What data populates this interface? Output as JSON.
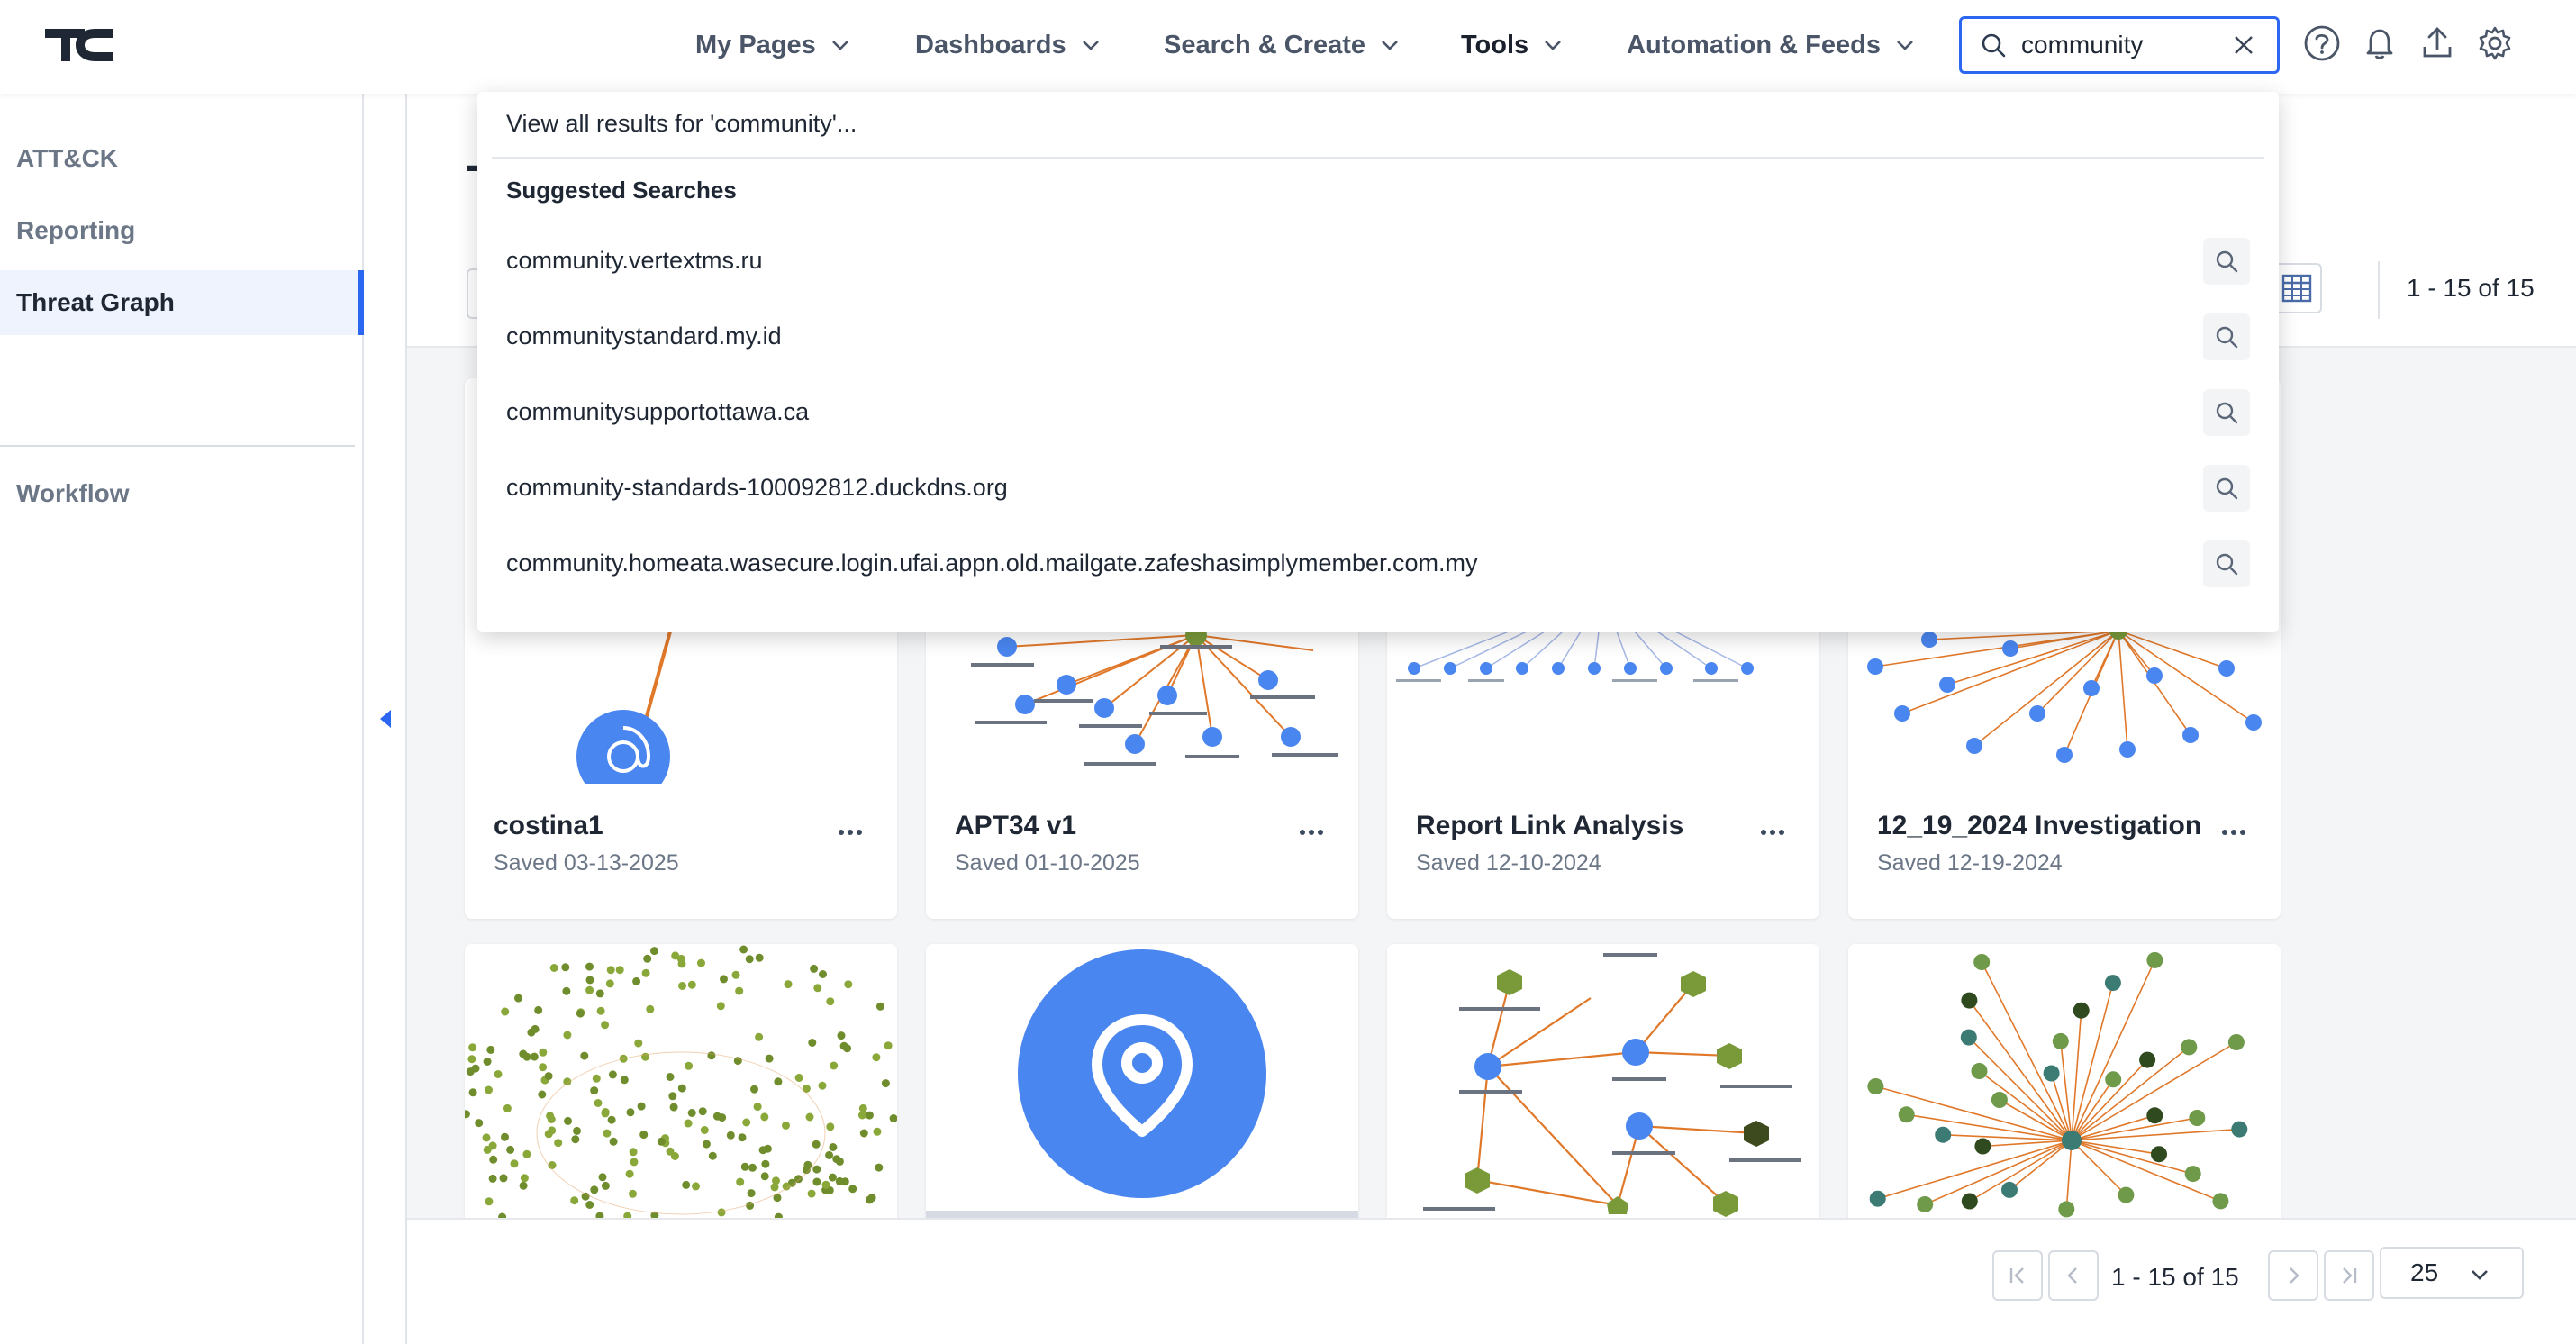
{
  "nav": {
    "items": [
      {
        "label": "My Pages"
      },
      {
        "label": "Dashboards"
      },
      {
        "label": "Search & Create"
      },
      {
        "label": "Tools"
      },
      {
        "label": "Automation & Feeds"
      }
    ],
    "search_value": "community"
  },
  "sidebar": {
    "items": [
      {
        "label": "ATT&CK"
      },
      {
        "label": "Reporting"
      },
      {
        "label": "Threat Graph"
      },
      {
        "label": "Workflow"
      }
    ]
  },
  "main": {
    "title_fragment": "T",
    "results_count": "1 - 15 of 15",
    "cards": [
      {
        "title": "costina1",
        "saved": "Saved 03-13-2025"
      },
      {
        "title": "APT34 v1",
        "saved": "Saved 01-10-2025"
      },
      {
        "title": "Report Link Analysis",
        "saved": "Saved 12-10-2024"
      },
      {
        "title": "12_19_2024 Investigation",
        "saved": "Saved 12-19-2024"
      }
    ]
  },
  "pagination": {
    "text": "1 - 15 of 15",
    "page_size": "25"
  },
  "search_dropdown": {
    "view_all": "View all results for 'community'...",
    "heading": "Suggested Searches",
    "suggestions": [
      "community.vertextms.ru",
      "communitystandard.my.id",
      "communitysupportottawa.ca",
      "community-standards-100092812.duckdns.org",
      "community.homeata.wasecure.login.ufai.appn.old.mailgate.zafeshasimplymember.com.my"
    ]
  },
  "colors": {
    "accent": "#2c67f2",
    "node_blue": "#4a86ef",
    "node_green": "#7a9a3a",
    "node_teal": "#3c7a74",
    "edge_orange": "#e0782a"
  },
  "icons": [
    "logo",
    "chevron-down-icon",
    "search-icon",
    "clear-icon",
    "help-icon",
    "bell-icon",
    "upload-icon",
    "gear-icon",
    "more-icon",
    "grid-view-icon",
    "table-view-icon",
    "location-pin-icon",
    "email-icon"
  ]
}
